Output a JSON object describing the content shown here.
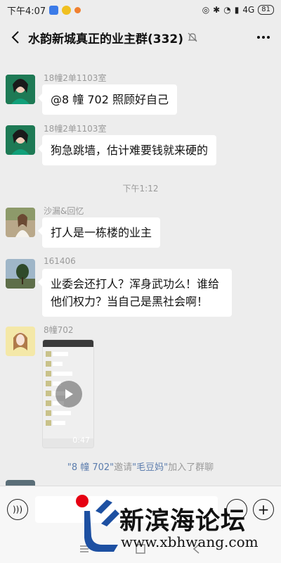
{
  "status_bar": {
    "time": "下午4:07",
    "network": "4G",
    "battery": "81"
  },
  "header": {
    "title": "水韵新城真正的业主群(332)"
  },
  "messages": [
    {
      "sender": "18幢2单1103室",
      "text": "@8 幢 702  照顾好自己"
    },
    {
      "sender": "18幢2单1103室",
      "text": "狗急跳墙，估计难要钱就来硬的"
    },
    {
      "sender": "沙漏&回忆",
      "text": "打人是一栋楼的业主"
    },
    {
      "sender": "161406",
      "text": "业委会还打人？浑身武功么！谁给他们权力？当自己是黑社会啊！"
    },
    {
      "sender": "8幢702",
      "duration": "0:47"
    }
  ],
  "time_separators": [
    "下午1:12"
  ],
  "system_note": {
    "inviter": "\"8 幢 702\"",
    "verb": "邀请",
    "invitee": "\"毛豆妈\"",
    "action": "加入了群聊"
  },
  "watermark": {
    "name": "新滨海论坛",
    "url": "www.xbhwang.com"
  },
  "colors": {
    "background": "#ededed",
    "bubble": "#ffffff",
    "link": "#5b7cad",
    "logo_red": "#e60012",
    "logo_blue": "#1d50a2"
  }
}
